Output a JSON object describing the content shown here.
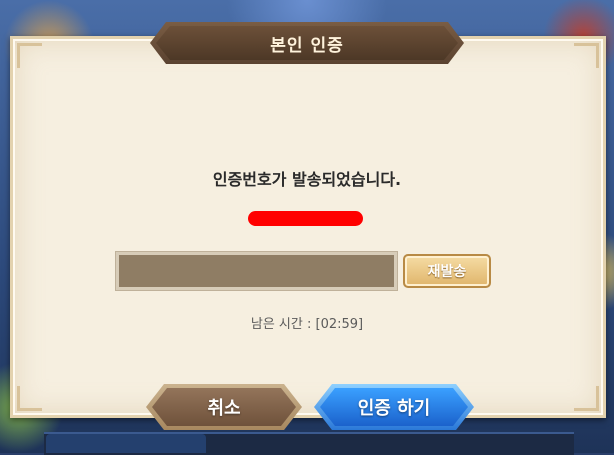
{
  "dialog": {
    "title": "본인 인증",
    "message": "인증번호가 발송되었습니다.",
    "code_input": {
      "value": "",
      "placeholder": ""
    },
    "resend_label": "재발송",
    "timer_text": "남은 시간 : [02:59]",
    "cancel_label": "취소",
    "confirm_label": "인증 하기"
  },
  "colors": {
    "panel": "#f6efe0",
    "banner": "#5a4230",
    "input": "#8f7d64",
    "resend": "#e0b56b",
    "cancel": "#7f6249",
    "confirm": "#2a78d8",
    "redaction": "#ff0000"
  }
}
